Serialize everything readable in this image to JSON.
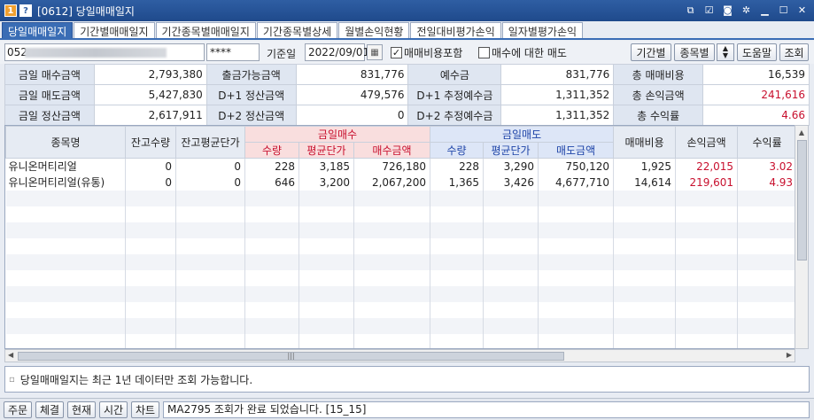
{
  "window": {
    "title": "[0612] 당일매매일지",
    "badge_one": "1",
    "badge_q": "?"
  },
  "tabs": [
    {
      "label": "당일매매일지",
      "active": true
    },
    {
      "label": "기간별매매일지"
    },
    {
      "label": "기간종목별매매일지"
    },
    {
      "label": "기간종목별상세"
    },
    {
      "label": "월별손익현황"
    },
    {
      "label": "전일대비평가손익"
    },
    {
      "label": "일자별평가손익"
    }
  ],
  "query": {
    "account_prefix": "052-",
    "password": "****",
    "date_label": "기준일",
    "date_value": "2022/09/01",
    "check_fee_label": "매매비용포함",
    "check_fee_checked": true,
    "check_buy_label": "매수에 대한 매도",
    "check_buy_checked": false,
    "btn_period": "기간별",
    "btn_item": "종목별",
    "btn_help": "도움말",
    "btn_query": "조회"
  },
  "summary": [
    [
      {
        "k": "금일 매수금액",
        "v": "2,793,380"
      },
      {
        "k": "출금가능금액",
        "v": "831,776"
      },
      {
        "k": "예수금",
        "v": "831,776"
      },
      {
        "k": "총 매매비용",
        "v": "16,539"
      }
    ],
    [
      {
        "k": "금일 매도금액",
        "v": "5,427,830"
      },
      {
        "k": "D+1 정산금액",
        "v": "479,576"
      },
      {
        "k": "D+1 추정예수금",
        "v": "1,311,352"
      },
      {
        "k": "총 손익금액",
        "v": "241,616",
        "red": true
      }
    ],
    [
      {
        "k": "금일 정산금액",
        "v": "2,617,911"
      },
      {
        "k": "D+2 정산금액",
        "v": "0"
      },
      {
        "k": "D+2 추정예수금",
        "v": "1,311,352"
      },
      {
        "k": "총 수익률",
        "v": "4.66",
        "red": true
      }
    ]
  ],
  "grid": {
    "headers": {
      "name": "종목명",
      "hold_qty": "잔고수량",
      "hold_avg": "잔고평균단가",
      "buy_group": "금일매수",
      "sell_group": "금일매도",
      "qty": "수량",
      "avg": "평균단가",
      "buy_amt": "매수금액",
      "sell_amt": "매도금액",
      "fee": "매매비용",
      "pnl": "손익금액",
      "rate": "수익률"
    },
    "rows": [
      {
        "name": "유니온머티리얼",
        "hold_qty": "0",
        "hold_avg": "0",
        "buy_qty": "228",
        "buy_avg": "3,185",
        "buy_amt": "726,180",
        "sell_qty": "228",
        "sell_avg": "3,290",
        "sell_amt": "750,120",
        "fee": "1,925",
        "pnl": "22,015",
        "rate": "3.02"
      },
      {
        "name": "유니온머티리얼(유통)",
        "hold_qty": "0",
        "hold_avg": "0",
        "buy_qty": "646",
        "buy_avg": "3,200",
        "buy_amt": "2,067,200",
        "sell_qty": "1,365",
        "sell_avg": "3,426",
        "sell_amt": "4,677,710",
        "fee": "14,614",
        "pnl": "219,601",
        "rate": "4.93"
      }
    ],
    "empty_rows": 10
  },
  "notice": "당일매매일지는 최근 1년 데이터만 조회 가능합니다.",
  "status": {
    "buttons": [
      "주문",
      "체결",
      "현재",
      "시간",
      "차트"
    ],
    "message": "MA2795 조회가 완료 되었습니다. [15_15]"
  },
  "colors": {
    "accent": "#3a6db5",
    "buy": "#c8102e",
    "sell": "#1e44a8"
  }
}
